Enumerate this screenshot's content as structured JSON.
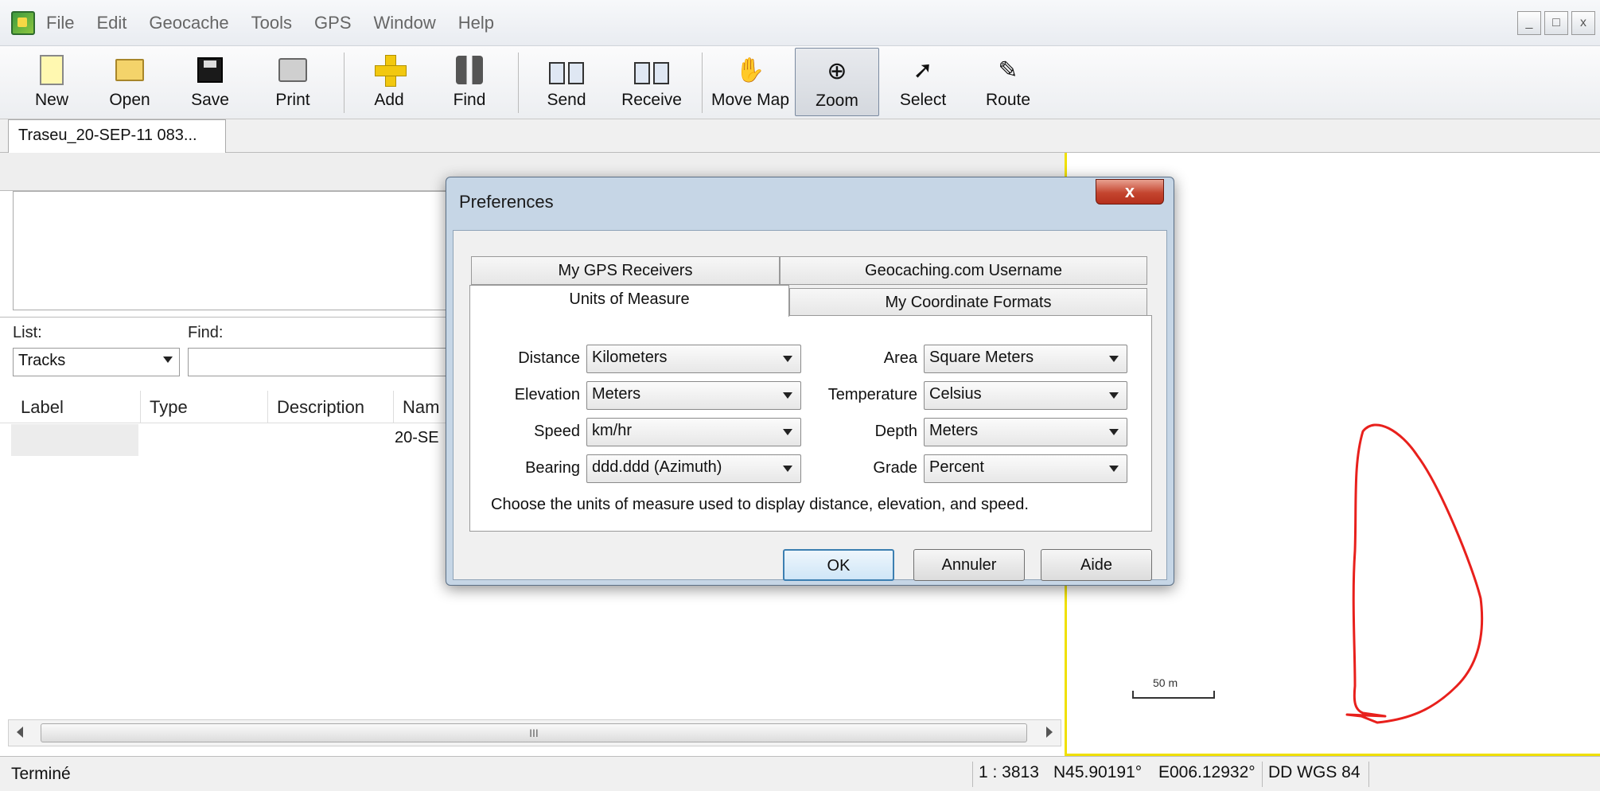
{
  "menu": {
    "items": [
      "File",
      "Edit",
      "Geocache",
      "Tools",
      "GPS",
      "Window",
      "Help"
    ],
    "window_controls": [
      "_",
      "□",
      "x"
    ]
  },
  "toolbar": {
    "new": "New",
    "open": "Open",
    "save": "Save",
    "print": "Print",
    "add": "Add",
    "find": "Find",
    "send": "Send",
    "receive": "Receive",
    "move_map": "Move Map",
    "zoom": "Zoom",
    "select": "Select",
    "route": "Route"
  },
  "doc_tab": {
    "label": "Traseu_20-SEP-11 083..."
  },
  "list_panel": {
    "list_label": "List:",
    "find_label": "Find:",
    "list_value": "Tracks",
    "columns": [
      "Label",
      "Type",
      "Description",
      "Nam"
    ],
    "row_name": "20-SE"
  },
  "hscroll": {
    "grip": "III"
  },
  "map": {
    "scale_label": "50 m",
    "track_color": "#e8201c",
    "frame_color": "#f0e000"
  },
  "status": {
    "text": "Terminé",
    "scale": "1 : 3813",
    "lat": "N45.90191°",
    "lon": "E006.12932°",
    "datum": "DD WGS 84"
  },
  "dialog": {
    "title": "Preferences",
    "close": "x",
    "tabs": {
      "gps_receivers": "My GPS Receivers",
      "geocaching_username": "Geocaching.com Username",
      "units_of_measure": "Units of Measure",
      "coordinate_formats": "My Coordinate Formats"
    },
    "fields": {
      "distance": {
        "label": "Distance",
        "value": "Kilometers"
      },
      "elevation": {
        "label": "Elevation",
        "value": "Meters"
      },
      "speed": {
        "label": "Speed",
        "value": "km/hr"
      },
      "bearing": {
        "label": "Bearing",
        "value": "ddd.ddd (Azimuth)"
      },
      "area": {
        "label": "Area",
        "value": "Square Meters"
      },
      "temperature": {
        "label": "Temperature",
        "value": "Celsius"
      },
      "depth": {
        "label": "Depth",
        "value": "Meters"
      },
      "grade": {
        "label": "Grade",
        "value": "Percent"
      }
    },
    "hint": "Choose the units of measure used to display distance, elevation, and speed.",
    "buttons": {
      "ok": "OK",
      "cancel": "Annuler",
      "help": "Aide"
    }
  }
}
